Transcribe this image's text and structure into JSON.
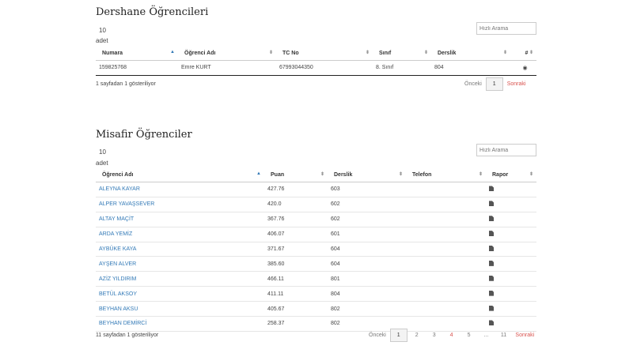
{
  "section1": {
    "title": "Dershane Öğrencileri",
    "length_value": "10",
    "length_suffix": "adet",
    "search_placeholder": "Hızlı Arama",
    "columns": [
      "Numara",
      "Öğrenci Adı",
      "TC No",
      "Sınıf",
      "Derslik",
      "#"
    ],
    "rows": [
      [
        "159825768",
        "Emre KURT",
        "67993044350",
        "8. Sınıf",
        "804",
        "eye-icon"
      ]
    ],
    "info": "1 sayfadan 1 gösteriliyor",
    "pager": {
      "prev": "Önceki",
      "pages": [
        "1"
      ],
      "next": "Sonraki"
    }
  },
  "section2": {
    "title": "Misafir Öğrenciler",
    "length_value": "10",
    "length_suffix": "adet",
    "search_placeholder": "Hızlı Arama",
    "columns": [
      "Öğrenci Adı",
      "Puan",
      "Derslik",
      "Telefon",
      "Rapor"
    ],
    "rows": [
      [
        "ALEYNA KAYAR",
        "427.76",
        "603",
        "",
        "doc-icon"
      ],
      [
        "ALPER YAVAŞSEVER",
        "420.0",
        "602",
        "",
        "doc-icon"
      ],
      [
        "ALTAY MAÇİT",
        "367.76",
        "602",
        "",
        "doc-icon"
      ],
      [
        "ARDA YEMİZ",
        "406.07",
        "601",
        "",
        "doc-icon"
      ],
      [
        "AYBÜKE KAYA",
        "371.67",
        "604",
        "",
        "doc-icon"
      ],
      [
        "AYŞEN ALVER",
        "385.60",
        "604",
        "",
        "doc-icon"
      ],
      [
        "AZİZ YILDIRIM",
        "466.11",
        "801",
        "",
        "doc-icon"
      ],
      [
        "BETÜL AKSOY",
        "411.11",
        "804",
        "",
        "doc-icon"
      ],
      [
        "BEYHAN AKSU",
        "405.67",
        "802",
        "",
        "doc-icon"
      ],
      [
        "BEYHAN DEMİRCİ",
        "258.37",
        "802",
        "",
        "doc-icon"
      ]
    ],
    "info": "11 sayfadan 1 gösteriliyor",
    "pager": {
      "prev": "Önceki",
      "pages": [
        "1",
        "2",
        "3",
        "4",
        "5",
        "...",
        "11"
      ],
      "next": "Sonraki"
    }
  },
  "colors": {
    "link": "#337ab7",
    "accent_red": "#d9534f"
  }
}
